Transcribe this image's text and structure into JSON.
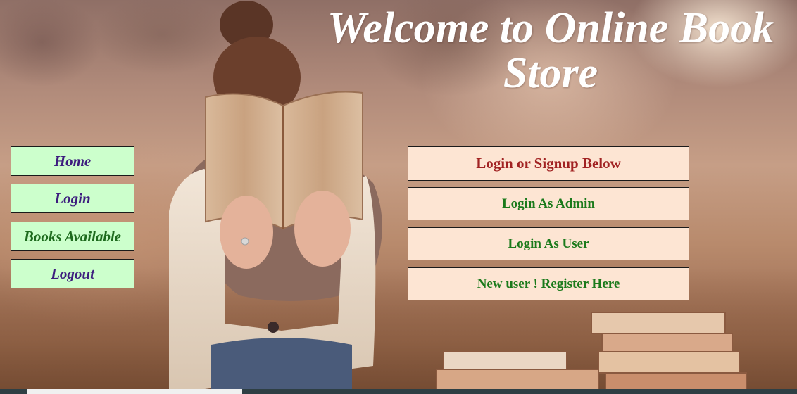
{
  "header": {
    "title_line1": "Welcome to Online Book",
    "title_line2": "Store"
  },
  "sidebar": {
    "items": [
      {
        "label": "Home"
      },
      {
        "label": "Login"
      },
      {
        "label": "Books Available"
      },
      {
        "label": "Logout"
      }
    ]
  },
  "panel": {
    "heading": "Login or Signup Below",
    "links": [
      {
        "label": "Login As Admin"
      },
      {
        "label": "Login As User"
      },
      {
        "label": "New user ! Register Here"
      }
    ]
  },
  "colors": {
    "nav_background": "#ccffcc",
    "nav_text": "#3d1d7e",
    "panel_background": "#fde5d3",
    "panel_heading": "#a12222",
    "panel_link": "#1b7a1b",
    "title_text": "#ffffff"
  },
  "scrollbar": {
    "thumb_position": 0.03,
    "thumb_fraction": 0.27
  }
}
